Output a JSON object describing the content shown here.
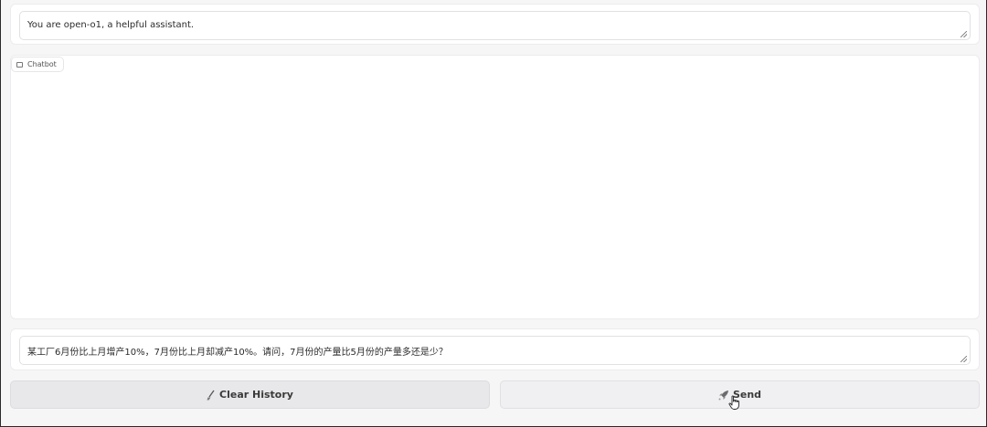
{
  "system_prompt": {
    "value": "You are open-o1, a helpful assistant."
  },
  "chatbot": {
    "label": "Chatbot",
    "icon": "chat-bubble-icon"
  },
  "user_input": {
    "value": "某工厂6月份比上月增产10%，7月份比上月却减产10%。请问，7月份的产量比5月份的产量多还是少？"
  },
  "buttons": {
    "clear_label": "Clear History",
    "clear_icon": "broom-icon",
    "send_label": "Send",
    "send_icon": "rocket-icon"
  }
}
